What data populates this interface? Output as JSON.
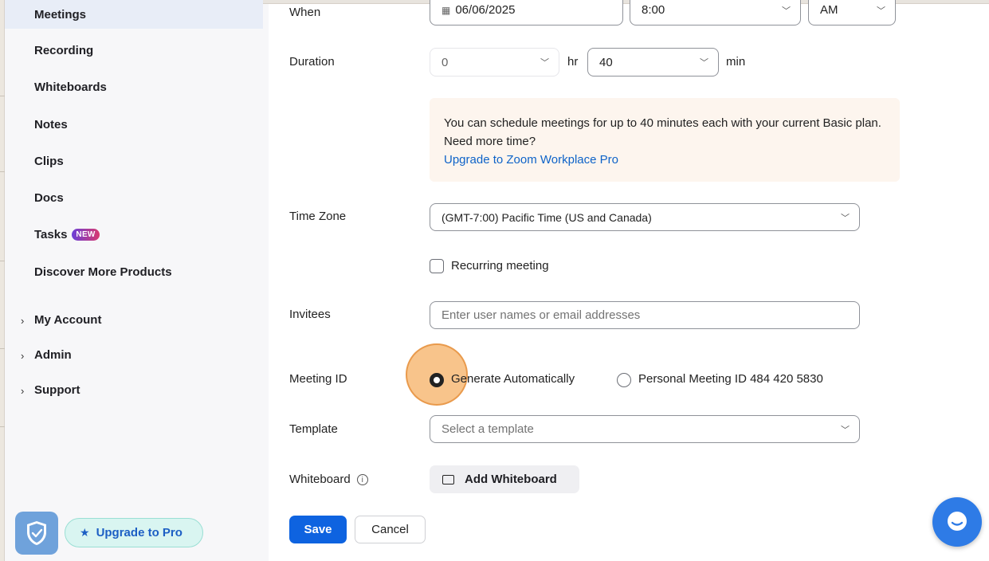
{
  "sidebar": {
    "items": [
      {
        "label": "Meetings"
      },
      {
        "label": "Recording"
      },
      {
        "label": "Whiteboards"
      },
      {
        "label": "Notes"
      },
      {
        "label": "Clips"
      },
      {
        "label": "Docs"
      },
      {
        "label": "Tasks",
        "badge": "NEW"
      },
      {
        "label": "Discover More Products"
      }
    ],
    "groups": [
      {
        "label": "My Account"
      },
      {
        "label": "Admin"
      },
      {
        "label": "Support"
      }
    ],
    "upgrade_label": "Upgrade to Pro"
  },
  "form": {
    "when": {
      "label": "When",
      "date": "06/06/2025",
      "time": "8:00",
      "ampm": "AM"
    },
    "duration": {
      "label": "Duration",
      "hours": "0",
      "hours_unit": "hr",
      "minutes": "40",
      "minutes_unit": "min"
    },
    "notice": {
      "text": "You can schedule meetings for up to 40 minutes each with your current Basic plan. Need more time?",
      "link": "Upgrade to Zoom Workplace Pro"
    },
    "timezone": {
      "label": "Time Zone",
      "value": "(GMT-7:00) Pacific Time (US and Canada)"
    },
    "recurring": {
      "label": "Recurring meeting",
      "checked": false
    },
    "invitees": {
      "label": "Invitees",
      "placeholder": "Enter user names or email addresses"
    },
    "meeting_id": {
      "label": "Meeting ID",
      "options": [
        {
          "label": "Generate Automatically",
          "selected": true
        },
        {
          "label": "Personal Meeting ID 484 420 5830",
          "selected": false
        }
      ]
    },
    "template": {
      "label": "Template",
      "placeholder": "Select a template"
    },
    "whiteboard": {
      "label": "Whiteboard",
      "button": "Add Whiteboard"
    },
    "save": "Save",
    "cancel": "Cancel"
  },
  "colors": {
    "primary": "#0e63e0",
    "link": "#0e63c8",
    "accent_highlight": "#f5b064"
  }
}
